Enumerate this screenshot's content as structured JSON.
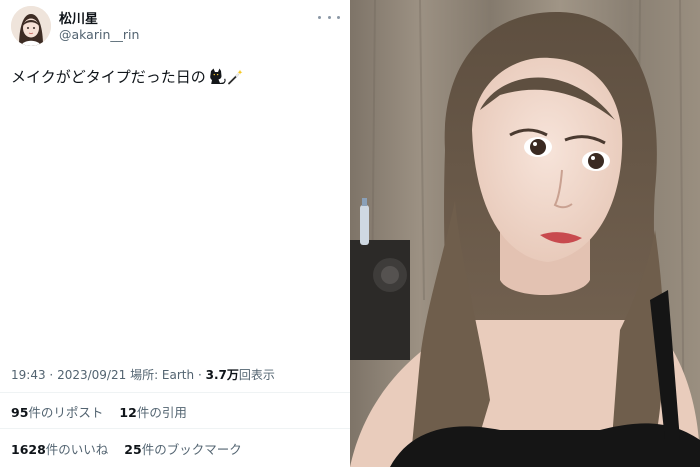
{
  "tweet": {
    "display_name": "松川星",
    "handle": "@akarin__rin",
    "text": "メイクがどタイプだった日の",
    "emoji_icons": [
      "black-cat-icon",
      "magic-wand-icon"
    ],
    "time": "19:43",
    "date": "2023/09/21",
    "location_label": "場所: Earth",
    "views_count": "3.7万",
    "views_label": "回表示",
    "separator": "·"
  },
  "stats": {
    "reposts_count": "95",
    "reposts_label": "件のリポスト",
    "quotes_count": "12",
    "quotes_label": "件の引用",
    "likes_count": "1628",
    "likes_label": "件のいいね",
    "bookmarks_count": "25",
    "bookmarks_label": "件のブックマーク"
  },
  "colors": {
    "text_primary": "#0f1419",
    "text_secondary": "#536471",
    "divider": "#eff3f4",
    "photo_curtain": "#8c8276",
    "photo_hair": "#6b5a48",
    "photo_dress": "#151515"
  }
}
